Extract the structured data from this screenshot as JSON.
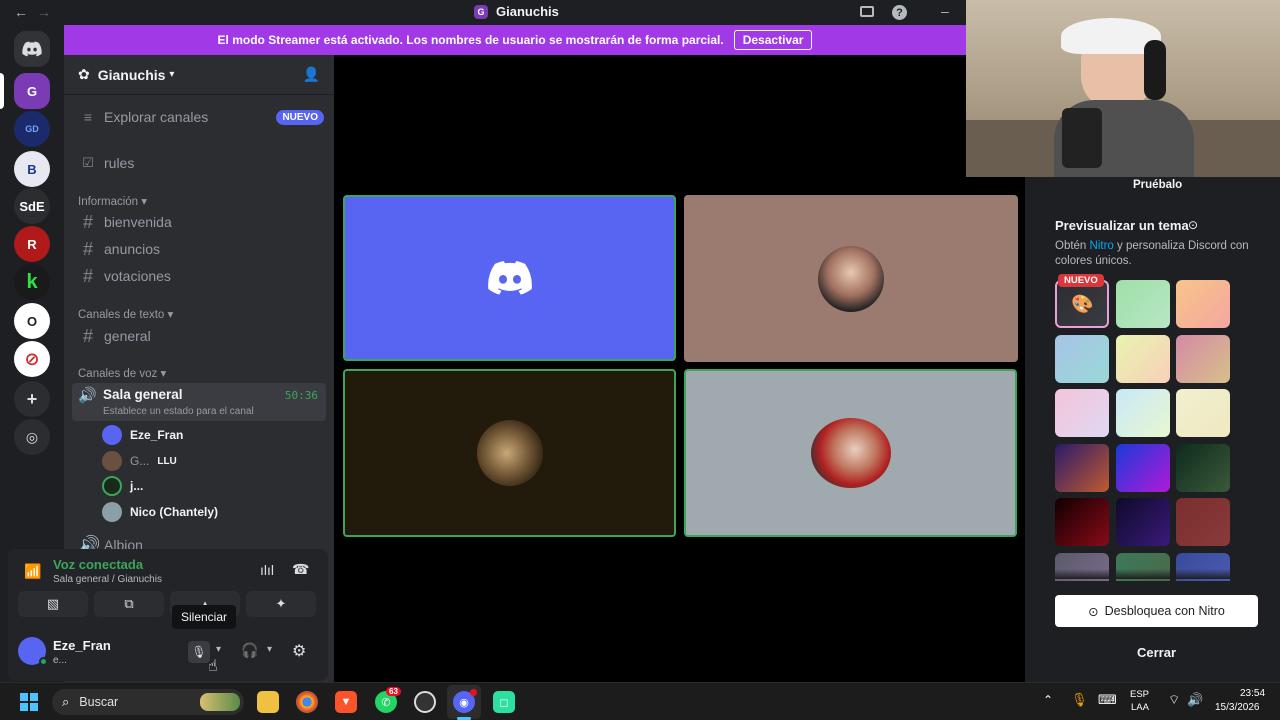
{
  "window": {
    "title": "Gianuchis",
    "server_initial": "G"
  },
  "banner": {
    "text": "El modo Streamer está activado. Los nombres de usuario se mostrarán de forma parcial.",
    "button": "Desactivar"
  },
  "rail": {
    "servers": [
      {
        "label": "G"
      },
      {
        "label": "GD"
      },
      {
        "label": "B"
      },
      {
        "label": "SdE"
      },
      {
        "label": "R"
      },
      {
        "label": "k"
      },
      {
        "label": "O"
      },
      {
        "label": "⊘"
      }
    ]
  },
  "sidebar": {
    "server_name": "Gianuchis",
    "explore": "Explorar canales",
    "explore_badge": "NUEVO",
    "rules": "rules",
    "categories": {
      "info": "Información",
      "text": "Canales de texto",
      "voice": "Canales de voz"
    },
    "info_channels": [
      "bienvenida",
      "anuncios",
      "votaciones"
    ],
    "text_channels": [
      "general"
    ],
    "voice_channel": {
      "name": "Sala general",
      "time": "50:36",
      "status_hint": "Establece un estado para el canal"
    },
    "members": [
      {
        "name": "Eze_Fran"
      },
      {
        "name": "G...",
        "tag": "LLU"
      },
      {
        "name": "j..."
      },
      {
        "name": "Nico (Chantely)"
      }
    ],
    "next_channel": "Albion"
  },
  "voice_panel": {
    "status": "Voz conectada",
    "location": "Sala general / Gianuchis",
    "tooltip": "Silenciar",
    "user_name": "Eze_Fran",
    "user_status": "e..."
  },
  "right_panel": {
    "try_label": "Pruébalo",
    "heading": "Previsualizar un tema",
    "desc_prefix": "Obtén ",
    "desc_link": "Nitro",
    "desc_suffix": " y personaliza Discord con colores únicos.",
    "new_badge": "NUEVO",
    "unlock_button": "Desbloquea con Nitro",
    "close_button": "Cerrar",
    "swatches": [
      "linear-gradient(135deg,#2b2d31,#3a3c43)",
      "linear-gradient(135deg,#9fe0a8,#b8e6c4)",
      "linear-gradient(135deg,#f8c48a,#f4a7a0)",
      "linear-gradient(135deg,#a7c4e8,#9ad8d6)",
      "linear-gradient(135deg,#e8f4b0,#f8d0b8)",
      "linear-gradient(135deg,#d48aa6,#d7c08a)",
      "linear-gradient(135deg,#f4c4d8,#e0d8f4)",
      "linear-gradient(135deg,#c8e8f8,#e8f8d0)",
      "linear-gradient(135deg,#f0f0d0,#f0e8c0)",
      "linear-gradient(135deg,#2a1a6a,#c05a30)",
      "linear-gradient(135deg,#1a3ad8,#b01ad8)",
      "linear-gradient(135deg,#0e2a1e,#3a5a3a)",
      "linear-gradient(135deg,#100000,#8a0a18)",
      "linear-gradient(135deg,#0e0a2a,#3a1a7a)",
      "linear-gradient(135deg,#7a2e2e,#8a3a3a)",
      "linear-gradient(135deg,#5a5a6a,#7a6a8a)",
      "linear-gradient(135deg,#3a7a5a,#4a6a4a)",
      "linear-gradient(135deg,#3a4a9a,#4a5ab0)"
    ]
  },
  "taskbar": {
    "search": "Buscar",
    "whatsapp_badge": "63",
    "lang_top": "ESP",
    "lang_bottom": "LAA",
    "time": "23:54",
    "date": "15/3/2026"
  },
  "colors": {
    "accent": "#5865f2",
    "banner": "#a239e6",
    "speaking": "#3ba55c"
  }
}
